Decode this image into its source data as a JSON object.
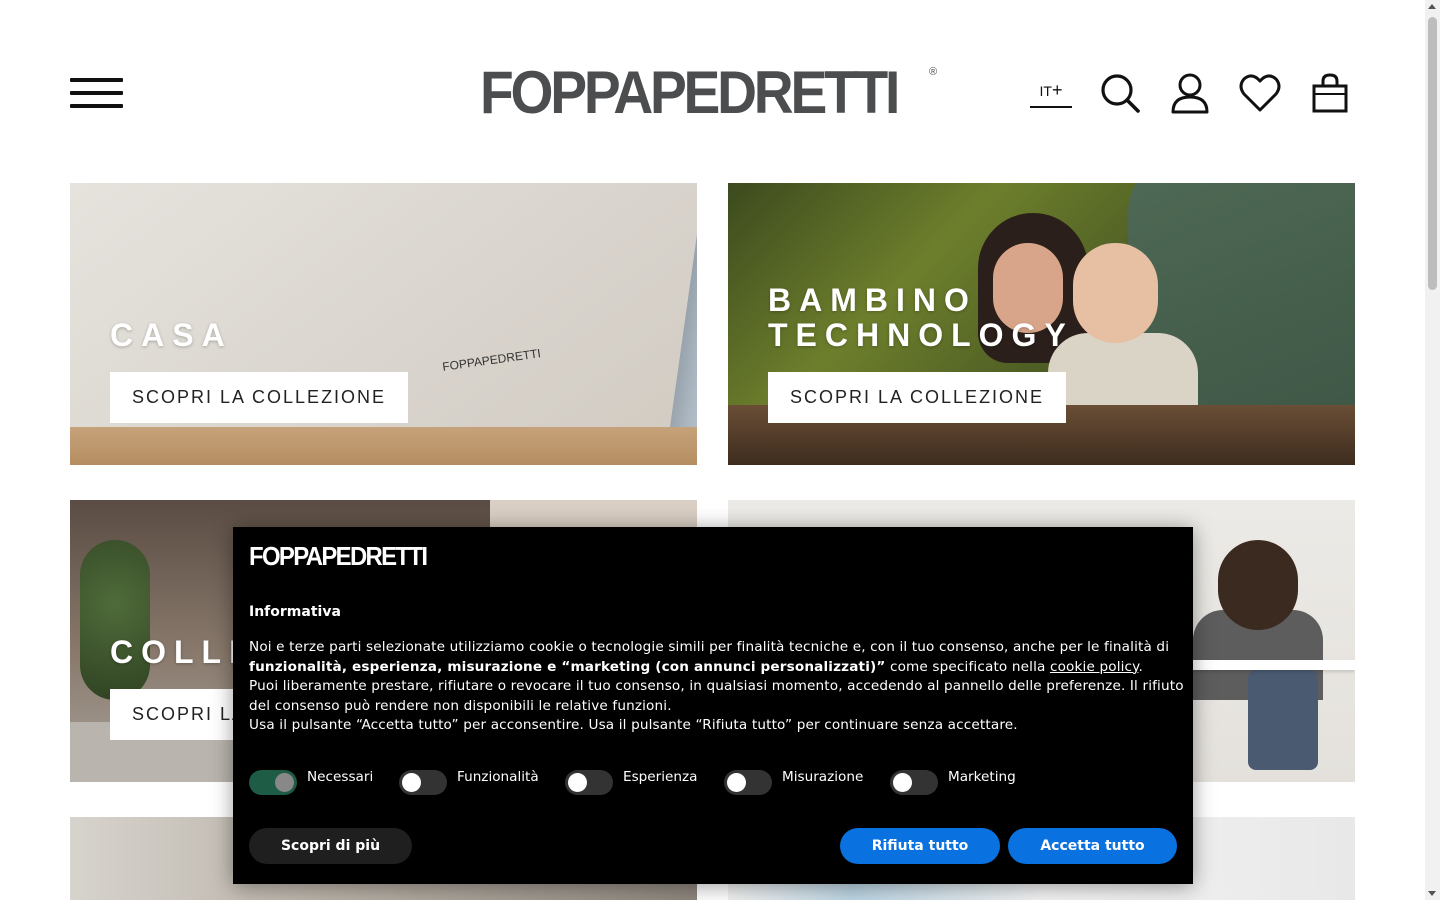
{
  "header": {
    "menu_icon": "hamburger-menu-icon",
    "logo_text": "FOPPAPEDRETTI",
    "logo_reg": "®",
    "language": "IT",
    "language_suffix": "+",
    "icons": [
      "search-icon",
      "user-icon",
      "heart-icon",
      "bag-icon"
    ]
  },
  "tiles": [
    {
      "title": "CASA",
      "button": "SCOPRI LA COLLEZIONE"
    },
    {
      "title_line1": "BAMBINO",
      "title_line2": "TECHNOLOGY",
      "button": "SCOPRI LA COLLEZIONE"
    },
    {
      "title": "COLLE",
      "button": "SCOPRI LA"
    },
    {
      "title": "",
      "button": ""
    }
  ],
  "tile1_stamp": "FOPPAPEDRETTI",
  "cookie": {
    "logo": "FOPPAPEDRETTI",
    "title": "Informativa",
    "p1_a": "Noi e terze parti selezionate utilizziamo cookie o tecnologie simili per finalità tecniche e, con il tuo consenso, anche per le finalità di ",
    "p1_bold": "funzionalità, esperienza, misurazione e “marketing (con annunci personalizzati)”",
    "p1_b": " come specificato nella ",
    "p1_link": "cookie policy",
    "p1_c": ".",
    "p2": "Puoi liberamente prestare, rifiutare o revocare il tuo consenso, in qualsiasi momento, accedendo al pannello delle preferenze. Il rifiuto del consenso può rendere non disponibili le relative funzioni.",
    "p3": "Usa il pulsante “Accetta tutto” per acconsentire. Usa il pulsante “Rifiuta tutto” per continuare senza accettare.",
    "toggles": [
      {
        "label": "Necessari",
        "on": true
      },
      {
        "label": "Funzionalità",
        "on": false
      },
      {
        "label": "Esperienza",
        "on": false
      },
      {
        "label": "Misurazione",
        "on": false
      },
      {
        "label": "Marketing",
        "on": false
      }
    ],
    "btn_more": "Scopri di più",
    "btn_reject": "Rifiuta tutto",
    "btn_accept": "Accetta tutto"
  },
  "colors": {
    "logo_gray": "#4b4d4f",
    "primary_blue": "#0a72e0",
    "toggle_on": "#1e5c45"
  }
}
